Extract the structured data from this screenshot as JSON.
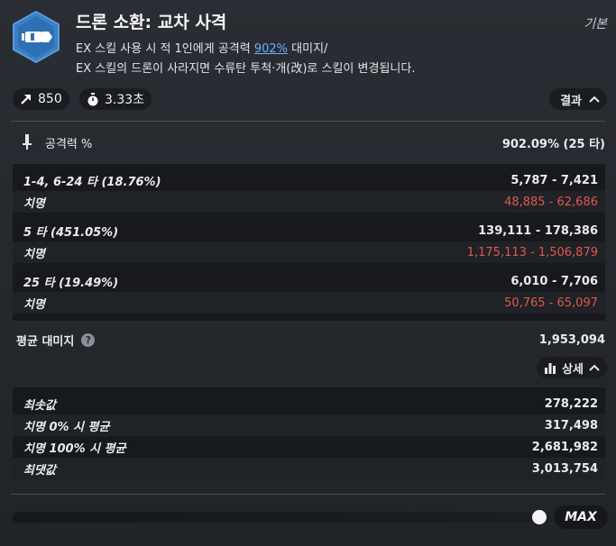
{
  "header": {
    "title": "드론 소환: 교차 사격",
    "tag": "기본",
    "desc_line1_pre": "EX 스킬 사용 시 적 1인에게 공격력 ",
    "desc_line1_highlight": "902%",
    "desc_line1_post": " 대미지/",
    "desc_line2": "EX 스킬의 드론이 사라지면 수류탄 투척·개(改)로 스킬이 변경됩니다."
  },
  "stats": {
    "range_value": "850",
    "time_value": "3.33초",
    "result_label": "결과"
  },
  "attack": {
    "label": "공격력 %",
    "value": "902.09% (25 타)"
  },
  "hits": [
    {
      "label": "1-4, 6-24 타 (18.76%)",
      "value": "5,787 - 7,421",
      "crit_label": "치명",
      "crit_value": "48,885 - 62,686"
    },
    {
      "label": "5 타 (451.05%)",
      "value": "139,111 - 178,386",
      "crit_label": "치명",
      "crit_value": "1,175,113 - 1,506,879"
    },
    {
      "label": "25 타 (19.49%)",
      "value": "6,010 - 7,706",
      "crit_label": "치명",
      "crit_value": "50,765 - 65,097"
    }
  ],
  "average": {
    "label": "평균 대미지",
    "help": "?",
    "value": "1,953,094"
  },
  "detail_label": "상세",
  "summary": [
    {
      "label": "최솟값",
      "value": "278,222"
    },
    {
      "label": "치명 0% 시 평균",
      "value": "317,498"
    },
    {
      "label": "치명 100% 시 평균",
      "value": "2,681,982"
    },
    {
      "label": "최댓값",
      "value": "3,013,754"
    }
  ],
  "slider": {
    "max_label": "MAX",
    "level_fraction": 1.0
  },
  "colors": {
    "highlight": "#6ab1ff",
    "crit": "#e05750",
    "icon_bg": "#3a7dc4"
  }
}
